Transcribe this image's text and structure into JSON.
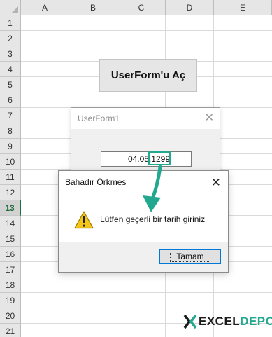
{
  "sheet": {
    "columns": [
      "A",
      "B",
      "C",
      "D",
      "E"
    ],
    "rows": [
      "1",
      "2",
      "3",
      "4",
      "5",
      "6",
      "7",
      "8",
      "9",
      "10",
      "11",
      "12",
      "13",
      "14",
      "15",
      "16",
      "17",
      "18",
      "19",
      "20",
      "21"
    ],
    "active_row": "13",
    "button_label": "UserForm'u Aç"
  },
  "userform": {
    "title": "UserForm1",
    "textbox_value": "04.05.1299"
  },
  "msgbox": {
    "title": "Bahadır Örkmes",
    "message": "Lütfen geçerli bir tarih giriniz",
    "ok_label": "Tamam",
    "icon": "warning-icon"
  },
  "watermark": {
    "brand_left": "EXCEL",
    "brand_right": "DEPO"
  },
  "colors": {
    "accent": "#22a88f",
    "active_row": "#1e7145"
  }
}
